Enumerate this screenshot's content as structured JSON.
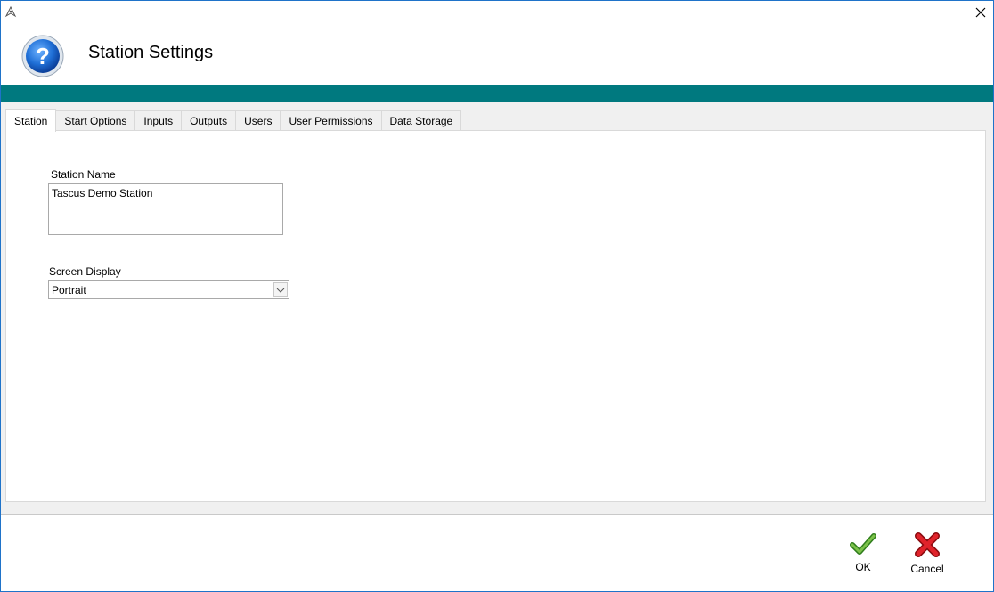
{
  "window": {
    "app_icon": "pen-nib-icon",
    "close_icon": "close-icon"
  },
  "header": {
    "icon": "help-question-icon",
    "title": "Station Settings"
  },
  "colors": {
    "accent_band": "#00797f",
    "window_border": "#1f73c9",
    "ok_check": "#4a9a2a",
    "cancel_x": "#d0121b"
  },
  "tabs": [
    {
      "label": "Station",
      "active": true
    },
    {
      "label": "Start Options",
      "active": false
    },
    {
      "label": "Inputs",
      "active": false
    },
    {
      "label": "Outputs",
      "active": false
    },
    {
      "label": "Users",
      "active": false
    },
    {
      "label": "User Permissions",
      "active": false
    },
    {
      "label": "Data Storage",
      "active": false
    }
  ],
  "station": {
    "name_label": "Station Name",
    "name_value": "Tascus Demo Station",
    "display_label": "Screen Display",
    "display_value": "Portrait"
  },
  "footer": {
    "ok_label": "OK",
    "ok_icon": "checkmark-icon",
    "cancel_label": "Cancel",
    "cancel_icon": "red-x-icon"
  }
}
